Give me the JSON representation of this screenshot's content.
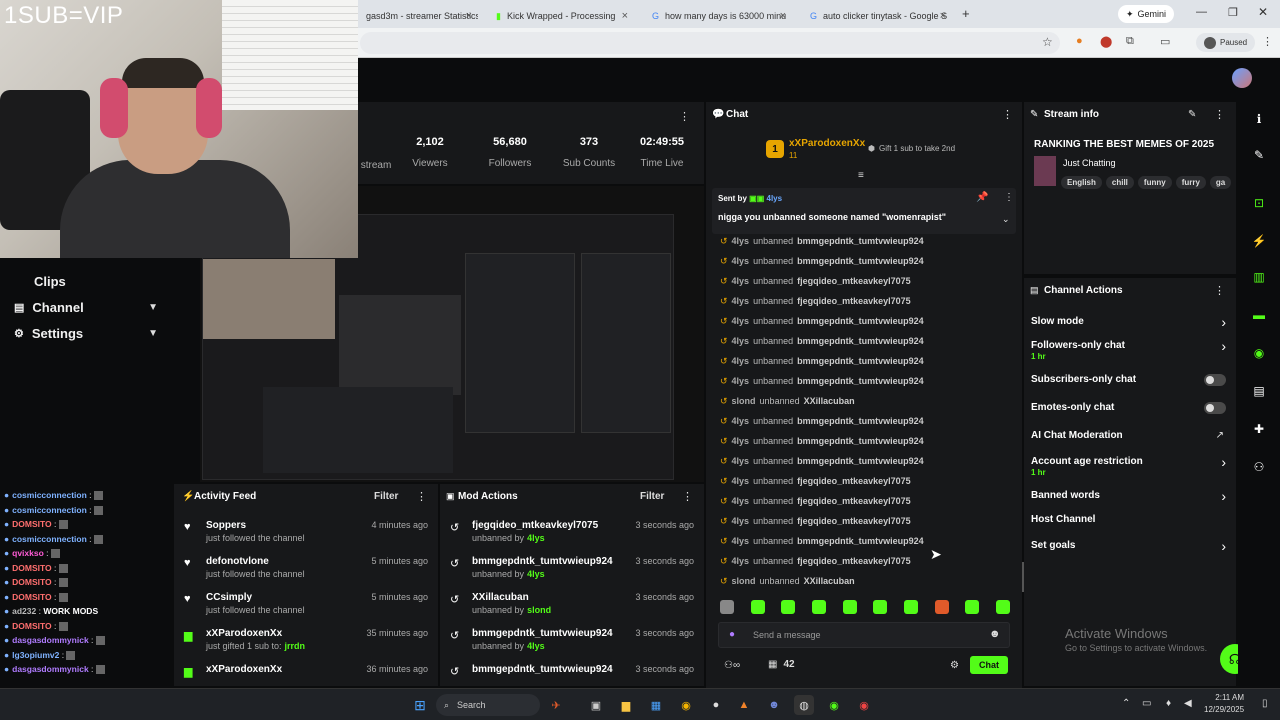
{
  "browser": {
    "tabs": [
      {
        "label": "gasd3m - streamer Statistics"
      },
      {
        "label": "Kick Wrapped - Processing"
      },
      {
        "label": "how many days is 63000 minu"
      },
      {
        "label": "auto clicker tinytask - Google S"
      }
    ],
    "new_tab": "+",
    "gemini": "Gemini",
    "paused": "Paused"
  },
  "overlay": {
    "sub_vip": "1SUB=VIP"
  },
  "sidebar": {
    "items": [
      {
        "label": "Clips"
      },
      {
        "label": "Channel"
      },
      {
        "label": "Settings"
      }
    ]
  },
  "left_chat": [
    {
      "user": "cosmicconnection",
      "color": "#7fb2ff"
    },
    {
      "user": "cosmicconnection",
      "color": "#7fb2ff"
    },
    {
      "user": "DOMSITO",
      "color": "#ff6f6f"
    },
    {
      "user": "cosmicconnection",
      "color": "#7fb2ff"
    },
    {
      "user": "qvixkso",
      "color": "#ff5cd6"
    },
    {
      "user": "DOMSITO",
      "color": "#ff6f6f"
    },
    {
      "user": "DOMSITO",
      "color": "#ff6f6f"
    },
    {
      "user": "DOMSITO",
      "color": "#ff6f6f"
    },
    {
      "user": "ad232",
      "color": "#bbbbbb",
      "text": "WORK MODS"
    },
    {
      "user": "DOMSITO",
      "color": "#ff6f6f"
    },
    {
      "user": "dasgasdommynick",
      "color": "#b07cff"
    },
    {
      "user": "lg3opiumv2",
      "color": "#7fb2ff"
    },
    {
      "user": "dasgasdommynick",
      "color": "#b07cff"
    }
  ],
  "stats": [
    {
      "value": "",
      "label": "stream"
    },
    {
      "value": "2,102",
      "label": "Viewers"
    },
    {
      "value": "56,680",
      "label": "Followers"
    },
    {
      "value": "373",
      "label": "Sub Counts"
    },
    {
      "value": "02:49:55",
      "label": "Time Live"
    }
  ],
  "activity_feed": {
    "title": "Activity Feed",
    "filter": "Filter",
    "items": [
      {
        "title": "Soppers",
        "sub": "just followed the channel",
        "time": "4 minutes ago",
        "icon": "heart"
      },
      {
        "title": "defonotvlone",
        "sub": "just followed the channel",
        "time": "5 minutes ago",
        "icon": "heart"
      },
      {
        "title": "CCsimply",
        "sub": "just followed the channel",
        "time": "5 minutes ago",
        "icon": "heart"
      },
      {
        "title": "xXParodoxenXx",
        "sub": "just gifted 1 sub to:",
        "target": "jrrdn",
        "time": "35 minutes ago",
        "icon": "gift"
      },
      {
        "title": "xXParodoxenXx",
        "sub": "",
        "time": "36 minutes ago",
        "icon": "gift"
      }
    ]
  },
  "mod_actions": {
    "title": "Mod Actions",
    "filter": "Filter",
    "items": [
      {
        "title": "fjegqideo_mtkeavkeyl7075",
        "sub": "unbanned by",
        "by": "4lys",
        "time": "3 seconds ago"
      },
      {
        "title": "bmmgepdntk_tumtvwieup924",
        "sub": "unbanned by",
        "by": "4lys",
        "time": "3 seconds ago"
      },
      {
        "title": "XXillacuban",
        "sub": "unbanned by",
        "by": "slond",
        "time": "3 seconds ago"
      },
      {
        "title": "bmmgepdntk_tumtvwieup924",
        "sub": "unbanned by",
        "by": "4lys",
        "time": "3 seconds ago"
      },
      {
        "title": "bmmgepdntk_tumtvwieup924",
        "sub": "",
        "by": "",
        "time": "3 seconds ago"
      }
    ]
  },
  "chat": {
    "title": "Chat",
    "top_gifter": {
      "rank": "1",
      "name": "xXParodoxenXx",
      "count": "11",
      "cta": "Gift 1 sub to take 2nd"
    },
    "pinned": {
      "label": "Sent by",
      "user": "4lys",
      "text": "nigga you unbanned someone named \"womenrapist\""
    },
    "messages": [
      {
        "mod": "4lys",
        "verb": "unbanned",
        "target": "bmmgepdntk_tumtvwieup924"
      },
      {
        "mod": "4lys",
        "verb": "unbanned",
        "target": "bmmgepdntk_tumtvwieup924"
      },
      {
        "mod": "4lys",
        "verb": "unbanned",
        "target": "fjegqideo_mtkeavkeyl7075"
      },
      {
        "mod": "4lys",
        "verb": "unbanned",
        "target": "fjegqideo_mtkeavkeyl7075"
      },
      {
        "mod": "4lys",
        "verb": "unbanned",
        "target": "bmmgepdntk_tumtvwieup924"
      },
      {
        "mod": "4lys",
        "verb": "unbanned",
        "target": "bmmgepdntk_tumtvwieup924"
      },
      {
        "mod": "4lys",
        "verb": "unbanned",
        "target": "bmmgepdntk_tumtvwieup924"
      },
      {
        "mod": "4lys",
        "verb": "unbanned",
        "target": "bmmgepdntk_tumtvwieup924"
      },
      {
        "mod": "slond",
        "verb": "unbanned",
        "target": "XXillacuban"
      },
      {
        "mod": "4lys",
        "verb": "unbanned",
        "target": "bmmgepdntk_tumtvwieup924"
      },
      {
        "mod": "4lys",
        "verb": "unbanned",
        "target": "bmmgepdntk_tumtvwieup924"
      },
      {
        "mod": "4lys",
        "verb": "unbanned",
        "target": "bmmgepdntk_tumtvwieup924"
      },
      {
        "mod": "4lys",
        "verb": "unbanned",
        "target": "fjegqideo_mtkeavkeyl7075"
      },
      {
        "mod": "4lys",
        "verb": "unbanned",
        "target": "fjegqideo_mtkeavkeyl7075"
      },
      {
        "mod": "4lys",
        "verb": "unbanned",
        "target": "fjegqideo_mtkeavkeyl7075"
      },
      {
        "mod": "4lys",
        "verb": "unbanned",
        "target": "bmmgepdntk_tumtvwieup924"
      },
      {
        "mod": "4lys",
        "verb": "unbanned",
        "target": "fjegqideo_mtkeavkeyl7075"
      },
      {
        "mod": "slond",
        "verb": "unbanned",
        "target": "XXillacuban"
      }
    ],
    "input_placeholder": "Send a message",
    "viewer_count": "42",
    "send_label": "Chat"
  },
  "stream_info": {
    "title": "Stream info",
    "stream_title": "RANKING THE BEST MEMES OF 2025",
    "category": "Just Chatting",
    "tags": [
      "English",
      "chill",
      "funny",
      "furry",
      "ga"
    ]
  },
  "channel_actions": {
    "title": "Channel Actions",
    "items": [
      {
        "label": "Slow mode",
        "sub": "",
        "control": "arrow"
      },
      {
        "label": "Followers-only chat",
        "sub": "1 hr",
        "control": "arrow"
      },
      {
        "label": "Subscribers-only chat",
        "sub": "",
        "control": "toggle"
      },
      {
        "label": "Emotes-only chat",
        "sub": "",
        "control": "toggle"
      },
      {
        "label": "AI Chat Moderation",
        "sub": "",
        "control": "external"
      },
      {
        "label": "Account age restriction",
        "sub": "1 hr",
        "control": "arrow"
      },
      {
        "label": "Banned words",
        "sub": "",
        "control": "arrow"
      },
      {
        "label": "Host Channel",
        "sub": "",
        "control": "none"
      },
      {
        "label": "Set goals",
        "sub": "",
        "control": "arrow"
      }
    ]
  },
  "watermark": {
    "line1": "Activate Windows",
    "line2": "Go to Settings to activate Windows."
  },
  "taskbar": {
    "search": "Search",
    "time": "2:11 AM",
    "date": "12/29/2025"
  },
  "colors": {
    "accent": "#53fc18",
    "panel": "#17181a",
    "background": "#0b0c0d"
  }
}
